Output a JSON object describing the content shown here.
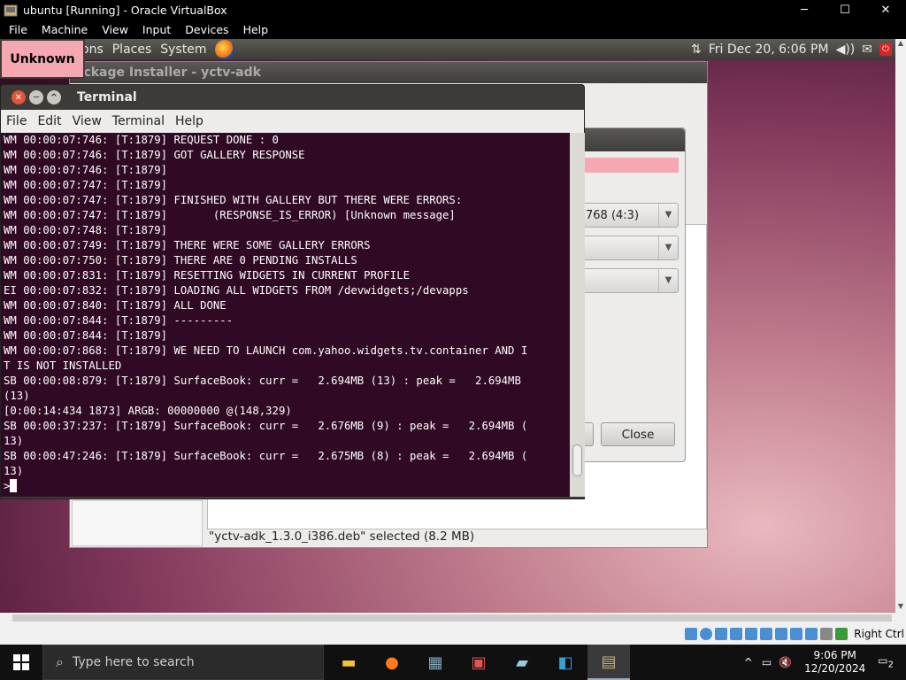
{
  "host": {
    "title": "ubuntu [Running] - Oracle VirtualBox",
    "menu": [
      "File",
      "Machine",
      "View",
      "Input",
      "Devices",
      "Help"
    ],
    "controls": {
      "minimize": "─",
      "maximize": "☐",
      "close": "✕"
    }
  },
  "guest": {
    "panel": {
      "menus": [
        "Applications",
        "Places",
        "System"
      ],
      "visible_menus": [
        "ons",
        "Places",
        "System"
      ],
      "clock": "Fri Dec 20,  6:06 PM",
      "network": "⇅",
      "volume": "◀))",
      "mail": "✉",
      "power": "⏻"
    },
    "badge": "Unknown",
    "pkg_installer": {
      "title": "ackage Installer - yctv-adk",
      "status": "\"yctv-adk_1.3.0_i386.deb\" selected (8.2 MB)"
    },
    "dialog": {
      "combo1": "768 (4:3)",
      "combo2": "",
      "combo3": "",
      "close_label": "Close"
    },
    "terminal": {
      "title": "Terminal",
      "menu": [
        "File",
        "Edit",
        "View",
        "Terminal",
        "Help"
      ],
      "lines": [
        "WM 00:00:07:746: [T:1879] REQUEST DONE : 0",
        "WM 00:00:07:746: [T:1879] GOT GALLERY RESPONSE",
        "WM 00:00:07:746: [T:1879]",
        "WM 00:00:07:747: [T:1879]",
        "WM 00:00:07:747: [T:1879] FINISHED WITH GALLERY BUT THERE WERE ERRORS:",
        "WM 00:00:07:747: [T:1879]       (RESPONSE_IS_ERROR) [Unknown message]",
        "WM 00:00:07:748: [T:1879]",
        "WM 00:00:07:749: [T:1879] THERE WERE SOME GALLERY ERRORS",
        "WM 00:00:07:750: [T:1879] THERE ARE 0 PENDING INSTALLS",
        "WM 00:00:07:831: [T:1879] RESETTING WIDGETS IN CURRENT PROFILE",
        "EI 00:00:07:832: [T:1879] LOADING ALL WIDGETS FROM /devwidgets;/devapps",
        "WM 00:00:07:840: [T:1879] ALL DONE",
        "WM 00:00:07:844: [T:1879] ---------",
        "WM 00:00:07:844: [T:1879]",
        "WM 00:00:07:868: [T:1879] WE NEED TO LAUNCH com.yahoo.widgets.tv.container AND I",
        "T IS NOT INSTALLED",
        "SB 00:00:08:879: [T:1879] SurfaceBook: curr =   2.694MB (13) : peak =   2.694MB",
        "(13)",
        "[0:00:14:434 1873] ARGB: 00000000 @(148,329)",
        "SB 00:00:37:237: [T:1879] SurfaceBook: curr =   2.676MB (9) : peak =   2.694MB (",
        "13)",
        "SB 00:00:47:246: [T:1879] SurfaceBook: curr =   2.675MB (8) : peak =   2.694MB (",
        "13)"
      ],
      "prompt": ">"
    }
  },
  "statusbar": {
    "host_key": "Right Ctrl"
  },
  "taskbar": {
    "search_placeholder": "Type here to search",
    "time": "9:06 PM",
    "date": "12/20/2024",
    "notification_count": "2",
    "apps": [
      "file-explorer-icon",
      "firefox-icon",
      "vm-manager-icon",
      "installer-icon",
      "notepad-icon",
      "vscode-icon",
      "virtualbox-icon"
    ]
  }
}
